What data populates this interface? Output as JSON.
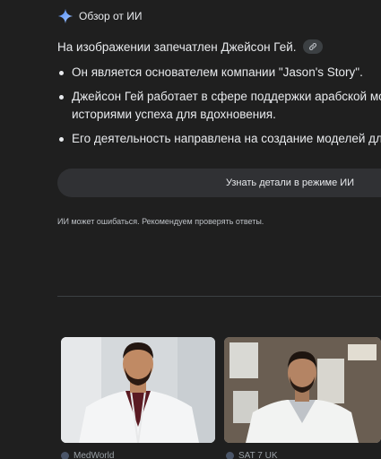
{
  "ai_overview": {
    "header_label": "Обзор от ИИ",
    "intro": "На изображении запечатлен Джейсон Гей.",
    "bullets": [
      {
        "lines": [
          "Он является основателем компании \"Jason's Story\"."
        ]
      },
      {
        "lines": [
          "Джейсон Гей работает в сфере поддержки арабской мо",
          "историями успеха для вдохновения."
        ]
      },
      {
        "lines": [
          "Его деятельность направлена на создание моделей дл"
        ]
      }
    ],
    "more_button_label": "Узнать детали в режиме ИИ",
    "disclaimer": "ИИ может ошибаться. Рекомендуем проверять ответы."
  },
  "colors": {
    "background": "#1f1f1f",
    "text": "#e8eaed",
    "button_bg": "#303134",
    "divider": "#3c4043",
    "sparkle": "#8ab4f8"
  },
  "icons": {
    "sparkle": "gemini-sparkle-icon",
    "link": "link-icon"
  },
  "image_results": [
    {
      "title": "man in white coat",
      "source": "MedWorld"
    },
    {
      "title": "man in white coat",
      "source": "SAT 7 UK"
    }
  ]
}
